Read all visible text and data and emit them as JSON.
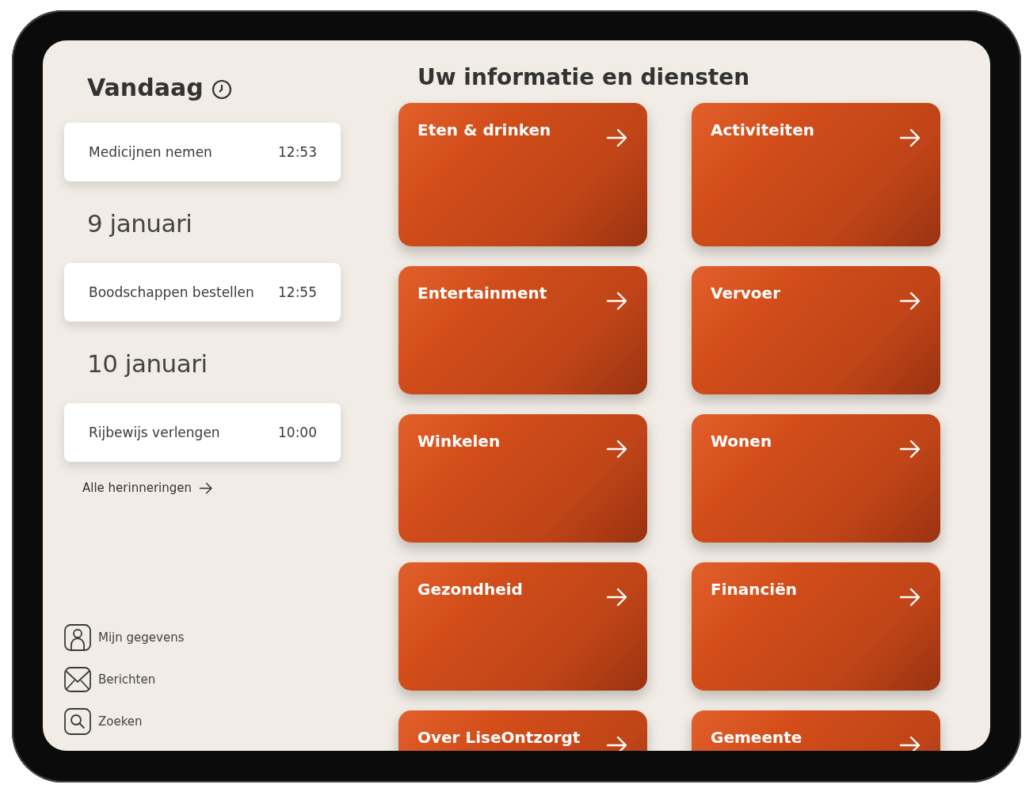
{
  "sidebar": {
    "title": "Vandaag",
    "agenda": [
      {
        "kind": "reminder",
        "title": "Medicijnen nemen",
        "time": "12:53"
      },
      {
        "kind": "date",
        "label": "9 januari"
      },
      {
        "kind": "reminder",
        "title": "Boodschappen bestellen",
        "time": "12:55"
      },
      {
        "kind": "date",
        "label": "10 januari"
      },
      {
        "kind": "reminder",
        "title": "Rijbewijs verlengen",
        "time": "10:00"
      }
    ],
    "all_link": "Alle herinneringen",
    "nav": [
      {
        "kind": "profile",
        "label": "Mijn gegevens"
      },
      {
        "kind": "messages",
        "label": "Berichten"
      },
      {
        "kind": "search",
        "label": "Zoeken"
      }
    ]
  },
  "services": {
    "title": "Uw informatie en diensten",
    "tiles": [
      "Eten & drinken",
      "Activiteiten",
      "Entertainment",
      "Vervoer",
      "Winkelen",
      "Wonen",
      "Gezondheid",
      "Financiën",
      "Over LiseOntzorgt",
      "Gemeente"
    ]
  }
}
